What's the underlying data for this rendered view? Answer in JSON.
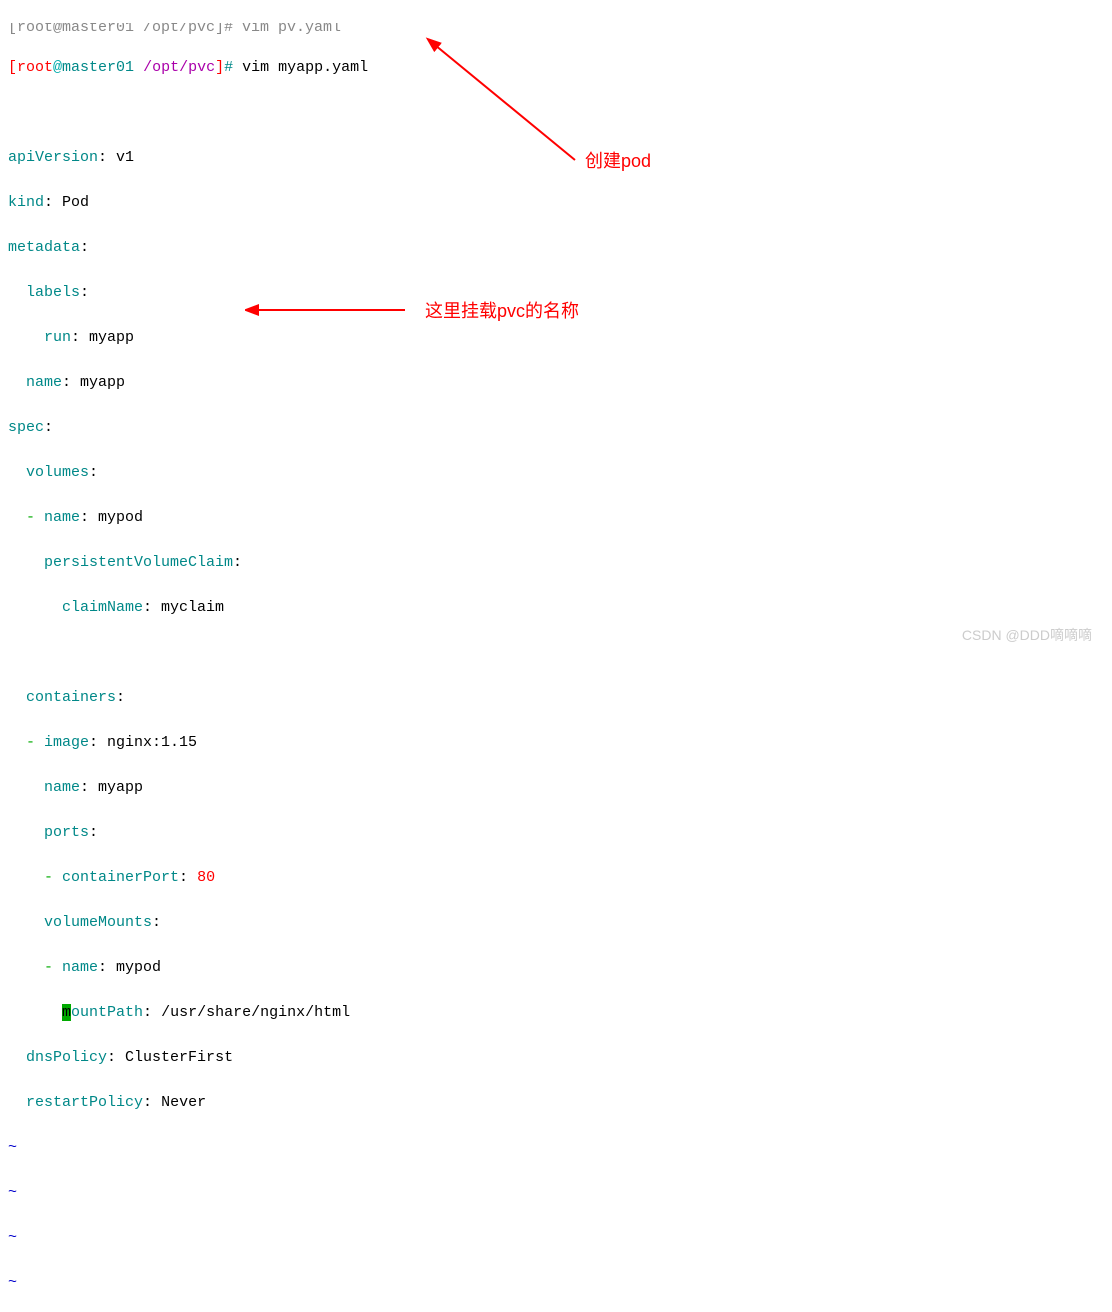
{
  "prompt": {
    "bracket_open": "[",
    "user": "root",
    "at": "@",
    "host": "master01",
    "path": " /opt/pvc",
    "bracket_close": "]",
    "hash": "#",
    "command": " vim myapp.yaml"
  },
  "yaml": {
    "apiVersion_key": "apiVersion",
    "apiVersion_val": " v1",
    "kind_key": "kind",
    "kind_val": " Pod",
    "metadata_key": "metadata",
    "labels_key": "labels",
    "run_key": "run",
    "run_val": " myapp",
    "name_key": "name",
    "name_val": " myapp",
    "spec_key": "spec",
    "volumes_key": "volumes",
    "vol_name_dash": "  - ",
    "vol_name_key": "name",
    "vol_name_val": " mypod",
    "pvc_key": "persistentVolumeClaim",
    "claimName_key": "claimName",
    "claimName_val": " myclaim",
    "containers_key": "containers",
    "image_dash": "  - ",
    "image_key": "image",
    "image_val": " nginx:1.15",
    "cname_key": "name",
    "cname_val": " myapp",
    "ports_key": "ports",
    "cport_dash": "    - ",
    "cport_key": "containerPort",
    "cport_val": " 80",
    "volumeMounts_key": "volumeMounts",
    "vm_name_dash": "    - ",
    "vm_name_key": "name",
    "vm_name_val": " mypod",
    "mountPath_m": "m",
    "mountPath_rest": "ountPath",
    "mountPath_val": " /usr/share/nginx/html",
    "dnsPolicy_key": "dnsPolicy",
    "dnsPolicy_val": " ClusterFirst",
    "restartPolicy_key": "restartPolicy",
    "restartPolicy_val": " Never",
    "tilde": "~",
    "colon": ":"
  },
  "annotations": {
    "create_pod": "创建pod",
    "pvc_name": "这里挂载pvc的名称"
  },
  "watermark": "CSDN @DDD嘀嘀嘀"
}
